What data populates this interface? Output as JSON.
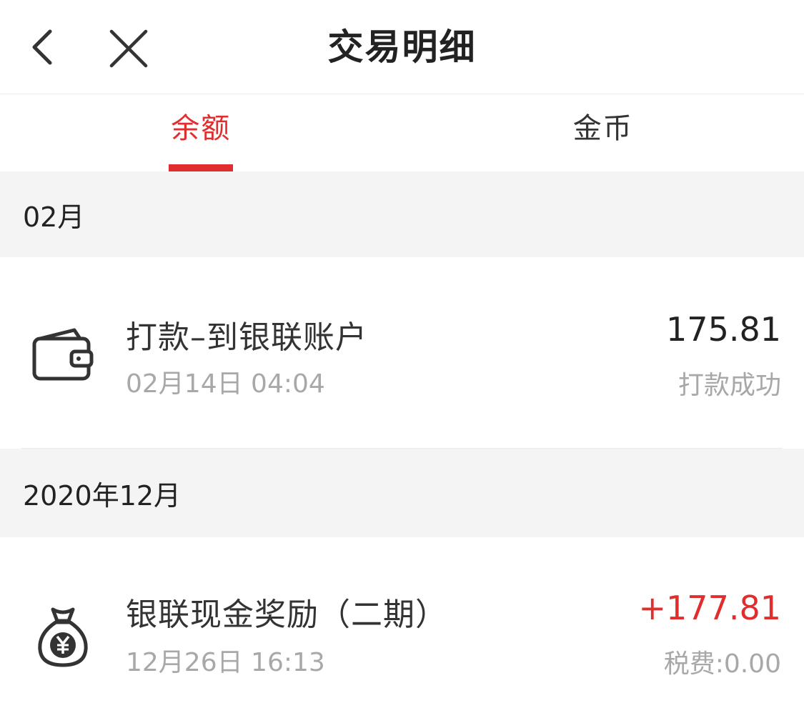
{
  "navbar": {
    "back_icon": "chevron-left-icon",
    "close_icon": "close-icon",
    "title": "交易明细"
  },
  "tabs": [
    {
      "label": "余额",
      "active": true
    },
    {
      "label": "金币",
      "active": false
    }
  ],
  "colors": {
    "accent": "#e02e2e",
    "section_bg": "#f4f4f4",
    "muted_text": "#a8a8a8"
  },
  "sections": [
    {
      "header": "02月",
      "items": [
        {
          "icon": "wallet-icon",
          "title": "打款–到银联账户",
          "time": "02月14日 04:04",
          "amount": "175.81",
          "status": "打款成功"
        }
      ]
    },
    {
      "header": "2020年12月",
      "items": [
        {
          "icon": "money-bag-icon",
          "title": "银联现金奖励（二期）",
          "time": "12月26日 16:13",
          "amount": "+177.81",
          "status": "税费:0.00"
        }
      ]
    }
  ]
}
